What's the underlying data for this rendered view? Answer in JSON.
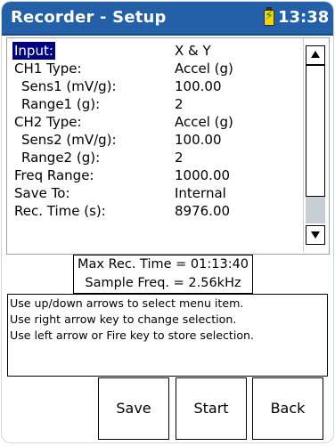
{
  "header": {
    "title": "Recorder - Setup",
    "battery_icon": "battery-charging-icon",
    "time": "13:38"
  },
  "settings": {
    "items": [
      {
        "label": "Input:",
        "value": "X & Y",
        "selected": true
      },
      {
        "label": "CH1 Type:",
        "value": "Accel (g)"
      },
      {
        "label": "Sens1 (mV/g):",
        "value": "100.00"
      },
      {
        "label": "Range1 (g):",
        "value": "2"
      },
      {
        "label": "CH2 Type:",
        "value": "Accel (g)"
      },
      {
        "label": "Sens2 (mV/g):",
        "value": "100.00"
      },
      {
        "label": "Range2 (g):",
        "value": "2"
      },
      {
        "label": "Freq Range:",
        "value": "1000.00"
      },
      {
        "label": "Save To:",
        "value": "Internal"
      },
      {
        "label": "Rec. Time (s):",
        "value": "8976.00"
      }
    ],
    "scrollbar": {
      "up_icon": "arrow-up-icon",
      "down_icon": "arrow-down-icon"
    }
  },
  "info": {
    "max_rec_time": "Max Rec. Time = 01:13:40",
    "sample_freq": "Sample Freq. = 2.56kHz"
  },
  "help": {
    "lines": [
      "Use up/down arrows to select menu item.",
      "Use right arrow key to change selection.",
      "Use left arrow or Fire key to store selection."
    ]
  },
  "buttons": {
    "save": "Save",
    "start": "Start",
    "back": "Back"
  },
  "colors": {
    "titlebar": "#2360a8",
    "selection": "#000080"
  }
}
